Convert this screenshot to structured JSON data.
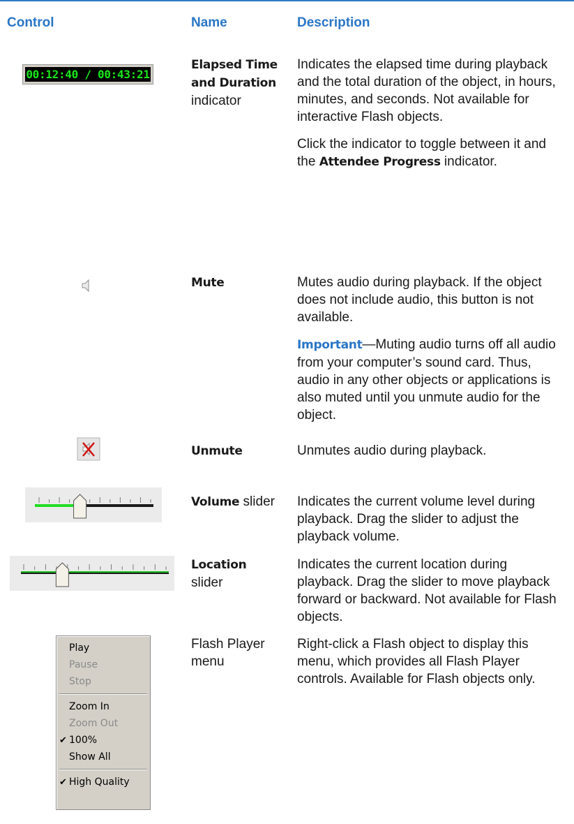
{
  "headers": {
    "control": "Control",
    "name": "Name",
    "description": "Description"
  },
  "rows": {
    "elapsed": {
      "display": "00:12:40 / 00:43:21",
      "name_bold_1": "Elapsed Time",
      "name_bold_2": "and Duration",
      "name_rest": "indicator",
      "desc1": "Indicates the elapsed time during playback and the total duration of the object, in hours, minutes, and seconds. Not available for interactive Flash objects.",
      "desc2_pre": "Click the indicator to toggle between it and the ",
      "desc2_bold": "Attendee Progress",
      "desc2_post": " indicator."
    },
    "mute": {
      "name": "Mute",
      "desc1": "Mutes audio during playback. If the object does not include audio, this button is not available.",
      "desc2_label": "Important",
      "desc2_rest": "—Muting audio turns off all audio from your computer’s sound card. Thus, audio in any other objects or applications is also muted until you unmute audio for the object."
    },
    "unmute": {
      "name": "Unmute",
      "desc": "Unmutes audio during playback."
    },
    "volume": {
      "name_bold": "Volume",
      "name_rest": " slider",
      "desc": "Indicates the current volume level during playback. Drag the slider to adjust the playback volume.",
      "level": 0.38
    },
    "location": {
      "name_bold": "Location",
      "name_rest": "slider",
      "desc": "Indicates the current location during playback. Drag the slider to move playback forward or backward. Not available for Flash objects.",
      "position": 0.28
    },
    "flash": {
      "name": "Flash Player menu",
      "desc": "Right-click a Flash object to display this menu, which provides all Flash Player controls. Available for Flash objects only.",
      "menu": {
        "play": "Play",
        "pause": "Pause",
        "stop": "Stop",
        "zoom_in": "Zoom In",
        "zoom_out": "Zoom Out",
        "hundred": "100%",
        "show_all": "Show All",
        "high_quality": "High Quality",
        "check": "✔"
      }
    }
  },
  "colors": {
    "heading": "#2a76c6",
    "rule": "#2f78c4",
    "timer_text": "#19e619",
    "slider_fill": "#22dd22"
  },
  "icons": {
    "mute": "speaker-icon",
    "unmute": "speaker-muted-icon"
  }
}
